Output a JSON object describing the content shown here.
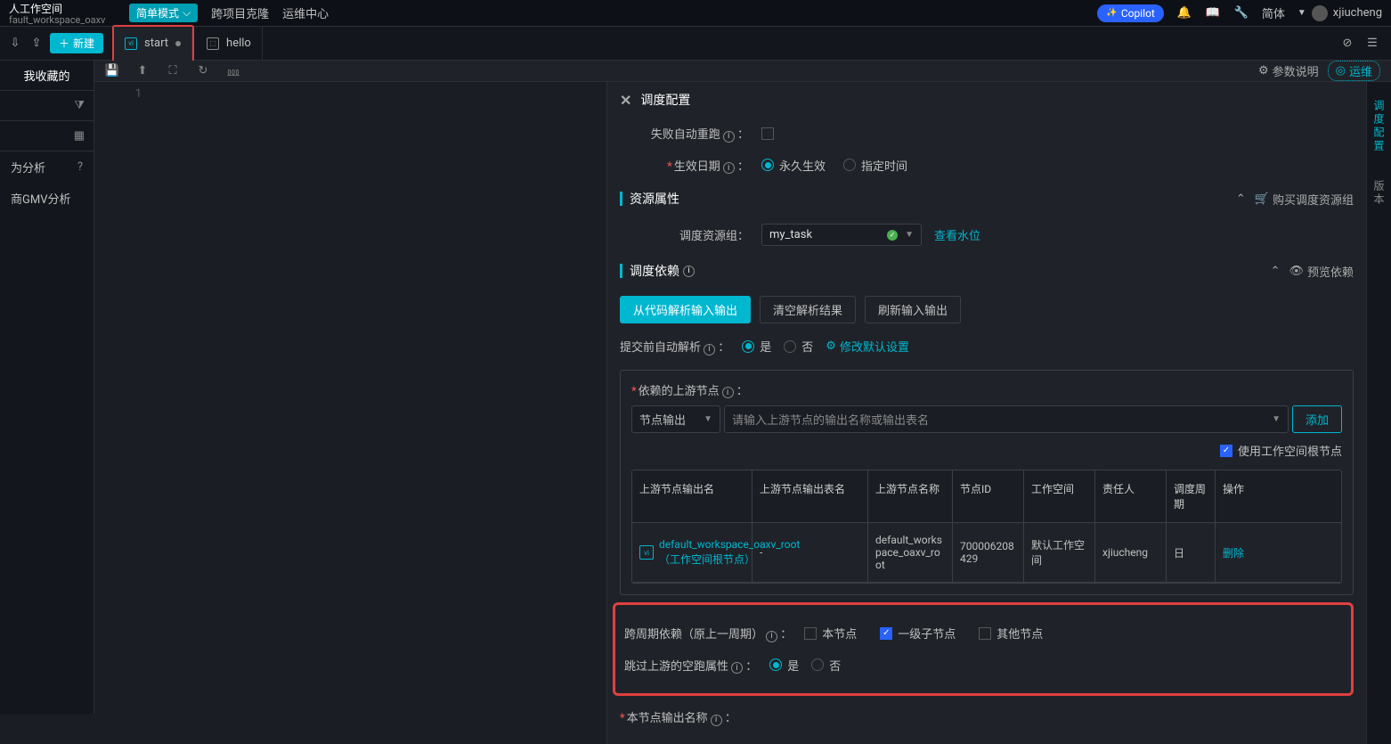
{
  "topbar": {
    "workspace_title": "人工作空间",
    "workspace_sub": "fault_workspace_oaxv",
    "mode": "简单模式",
    "links": [
      "跨项目克隆",
      "运维中心"
    ],
    "copilot": "Copilot",
    "lang": "简体",
    "user": "xjiucheng"
  },
  "tabbar": {
    "new": "新建",
    "tabs": [
      {
        "label": "start",
        "icon": "vi",
        "dirty": true,
        "active": true
      },
      {
        "label": "hello",
        "icon": "hl",
        "dirty": false,
        "active": false
      }
    ]
  },
  "sidebar": {
    "fav": "我收藏的",
    "items": [
      {
        "label": "为分析",
        "hint": true
      },
      {
        "label": "商GMV分析",
        "hint": false
      }
    ]
  },
  "toolbar": {
    "param_desc": "参数说明",
    "ops": "运维"
  },
  "editor": {
    "line": "1"
  },
  "config": {
    "title": "调度配置",
    "auto_rerun": "失败自动重跑",
    "effective_date": "生效日期",
    "forever": "永久生效",
    "specific": "指定时间",
    "resource_section": "资源属性",
    "buy_resource": "购买调度资源组",
    "resource_group_label": "调度资源组：",
    "resource_group_value": "my_task",
    "view_level": "查看水位",
    "dep_section": "调度依赖",
    "preview_dep": "预览依赖",
    "parse_btn": "从代码解析输入输出",
    "clear_btn": "清空解析结果",
    "refresh_btn": "刷新输入输出",
    "auto_parse_label": "提交前自动解析",
    "yes": "是",
    "no": "否",
    "modify_default": "修改默认设置",
    "upstream_label": "依赖的上游节点",
    "node_output": "节点输出",
    "input_placeholder": "请输入上游节点的输出名称或输出表名",
    "add": "添加",
    "use_root": "使用工作空间根节点",
    "table_headers": [
      "上游节点输出名",
      "上游节点输出表名",
      "上游节点名称",
      "节点ID",
      "工作空间",
      "责任人",
      "调度周期",
      "操作"
    ],
    "table_row": {
      "output_name": "default_workspace_oaxv_root（工作空间根节点）",
      "output_table": "-",
      "node_name": "default_workspace_oaxv_root",
      "node_id": "700006208429",
      "workspace": "默认工作空间",
      "owner": "xjiucheng",
      "period": "日",
      "action": "删除"
    },
    "cross_period_label": "跨周期依赖（原上一周期）",
    "cb_self": "本节点",
    "cb_first_child": "一级子节点",
    "cb_other": "其他节点",
    "skip_empty_label": "跳过上游的空跑属性",
    "output_name_label": "本节点输出名称"
  },
  "right_tabs": [
    "调度配置",
    "版本"
  ]
}
